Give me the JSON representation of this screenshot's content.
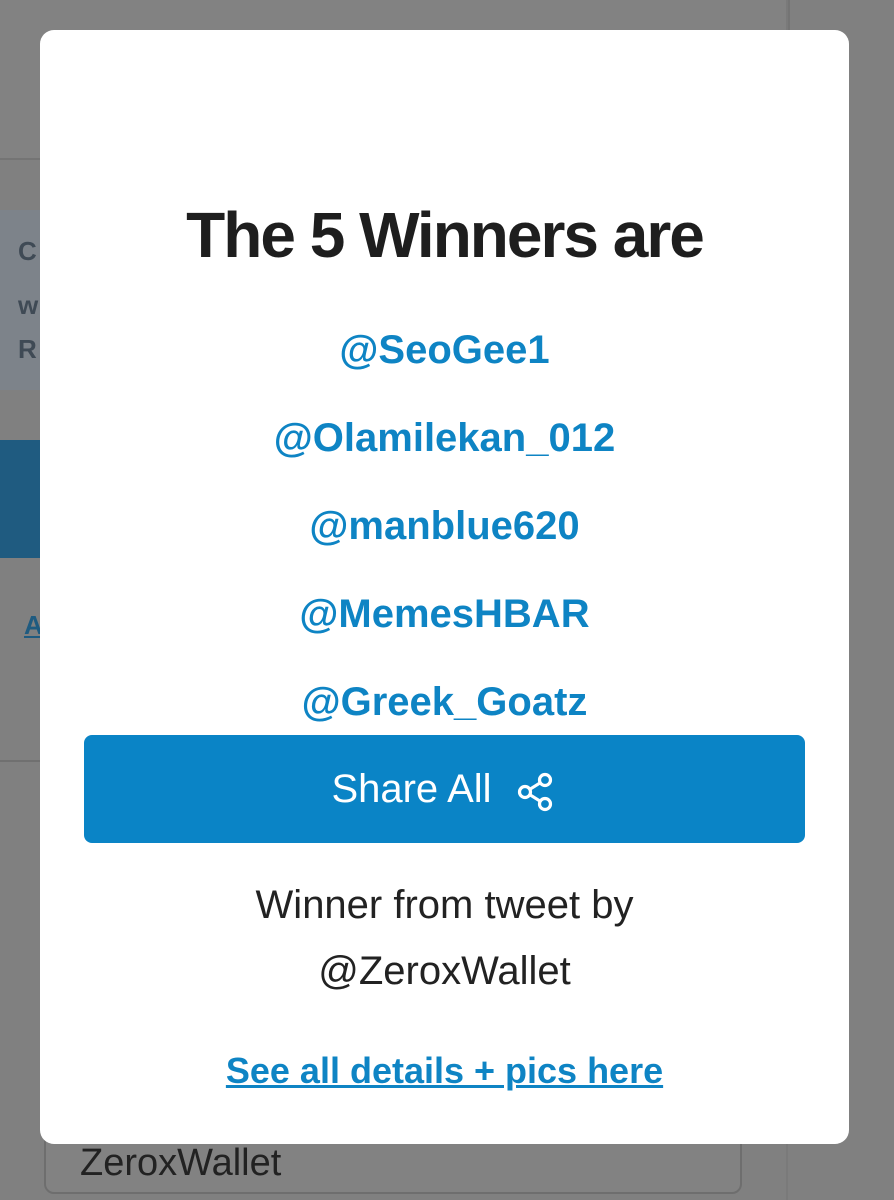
{
  "background": {
    "info_lines": [
      "C",
      "w",
      "R"
    ],
    "link_fragment": "A",
    "input_value": "ZeroxWallet"
  },
  "modal": {
    "title": "The 5 Winners are",
    "winners": [
      "@SeoGee1",
      "@Olamilekan_012",
      "@manblue620",
      "@MemesHBAR",
      "@Greek_Goatz"
    ],
    "share_button_label": "Share All",
    "share_icon": "share-icon",
    "tweet_line_1": "Winner from tweet by",
    "tweet_line_2": "@ZeroxWallet",
    "details_link": "See all details + pics here"
  },
  "colors": {
    "accent": "#0a84c6",
    "link": "#0e84c4",
    "overlay": "#808080",
    "title": "#1e1e1e"
  }
}
